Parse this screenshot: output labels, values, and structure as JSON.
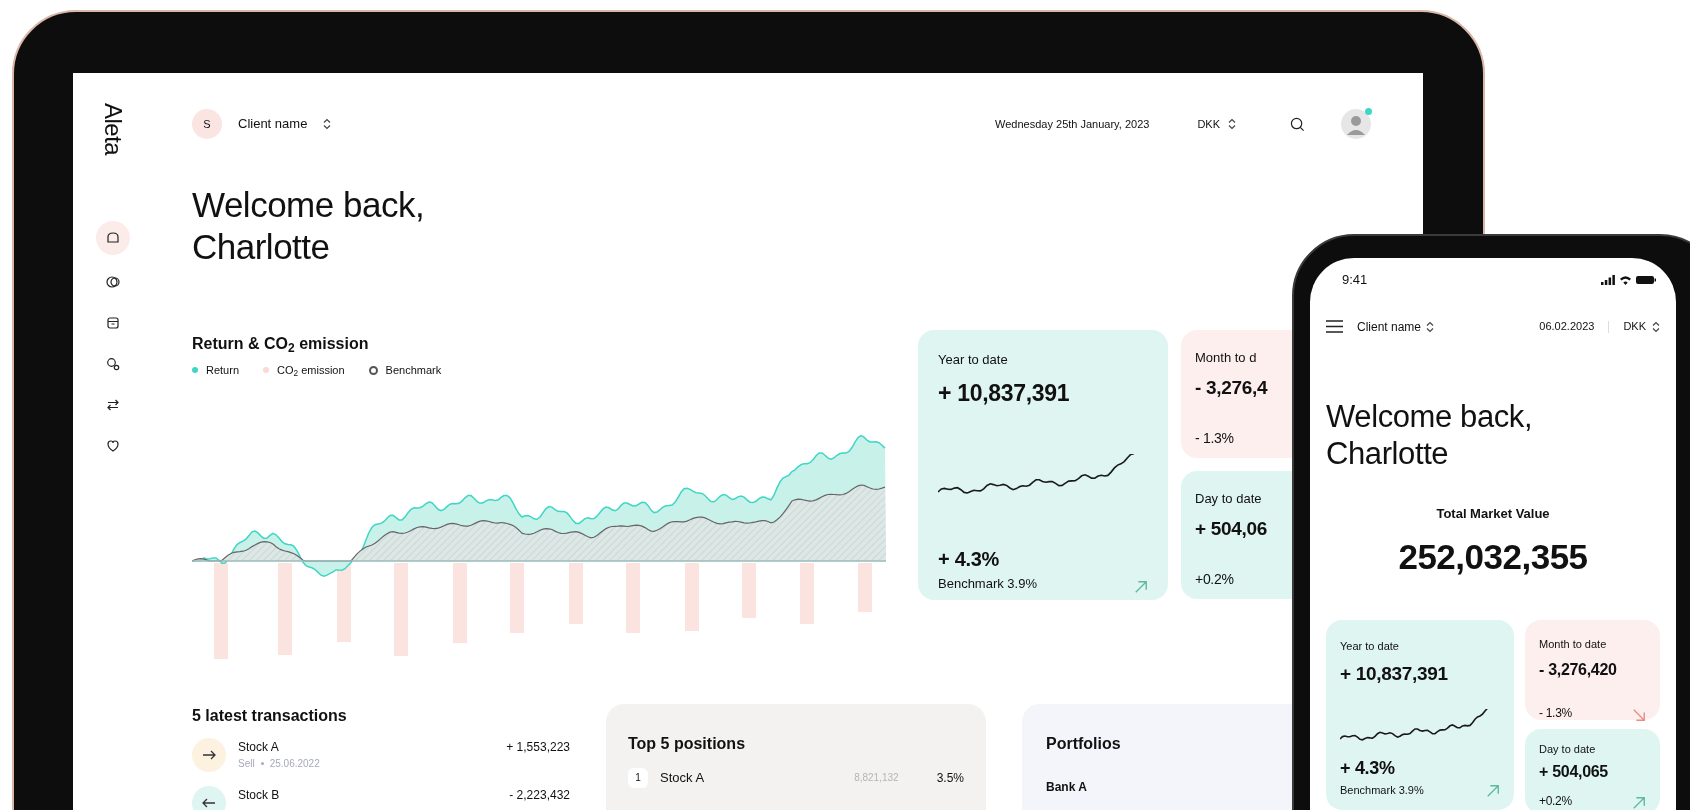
{
  "tablet": {
    "logo": "Aleta",
    "sidebar": {
      "items": [
        {
          "selected": true
        },
        {
          "selected": false
        },
        {
          "selected": false
        },
        {
          "selected": false
        },
        {
          "selected": false
        },
        {
          "selected": false
        }
      ]
    },
    "header": {
      "client_initial": "S",
      "client_name": "Client name",
      "date": "Wednesday 25th January, 2023",
      "currency": "DKK",
      "avatar": {
        "online": true
      }
    },
    "greeting": [
      "Welcome back,",
      "Charlotte"
    ],
    "chart": {
      "title": "Return & CO$_{2}$ emission",
      "legend": [
        {
          "label": "Return",
          "color": "#3fd6c6",
          "kind": "dot"
        },
        {
          "label": "CO$_{2}$ emission",
          "color": "#fbd9d5",
          "kind": "dot"
        },
        {
          "label": "Benchmark",
          "color": "#555555",
          "kind": "ring"
        }
      ]
    },
    "stats": [
      {
        "kind": "large",
        "label": "Year to date",
        "value": "+ 10,837,391",
        "percent": "+ 4.3%",
        "benchmark": "Benchmark 3.9%",
        "negative": false,
        "arrow": true
      },
      {
        "kind": "small",
        "label": "Month to d",
        "value": "- 3,276,4",
        "percent": "- 1.3%",
        "negative": true,
        "arrow": false
      },
      {
        "kind": "small",
        "label": "Day to date",
        "value": "+ 504,06",
        "percent": "+0.2%",
        "negative": false,
        "arrow": false
      }
    ],
    "transactions": {
      "title": "5 latest transactions",
      "rows": [
        {
          "kind": "sell",
          "name": "Stock A",
          "type": "Sell",
          "date": "25.06.2022",
          "amount": "+ 1,553,223"
        },
        {
          "kind": "buy",
          "name": "Stock B",
          "amount": "- 2,223,432"
        }
      ]
    },
    "positions": {
      "title": "Top 5 positions",
      "rows": [
        {
          "rank": "1",
          "name": "Stock A",
          "value": "8,821,132",
          "share": "3.5%"
        }
      ]
    },
    "portfolios": {
      "title": "Portfolios",
      "items": [
        {
          "name": "Bank A"
        }
      ]
    }
  },
  "phone": {
    "time": "9:41",
    "client_name": "Client name",
    "date": "06.02.2023",
    "currency": "DKK",
    "greeting": [
      "Welcome back,",
      "Charlotte"
    ],
    "total_label": "Total Market Value",
    "total_value": "252,032,355",
    "stats": [
      {
        "kind": "large",
        "label": "Year to date",
        "value": "+ 10,837,391",
        "percent": "+ 4.3%",
        "benchmark": "Benchmark 3.9%",
        "negative": false,
        "arrow": true
      },
      {
        "kind": "small",
        "label": "Month to date",
        "value": "- 3,276,420",
        "percent": "- 1.3%",
        "negative": true,
        "arrow": true
      },
      {
        "kind": "small",
        "label": "Day to date",
        "value": "+ 504,065",
        "percent": "+0.2%",
        "negative": false,
        "arrow": true
      }
    ]
  }
}
